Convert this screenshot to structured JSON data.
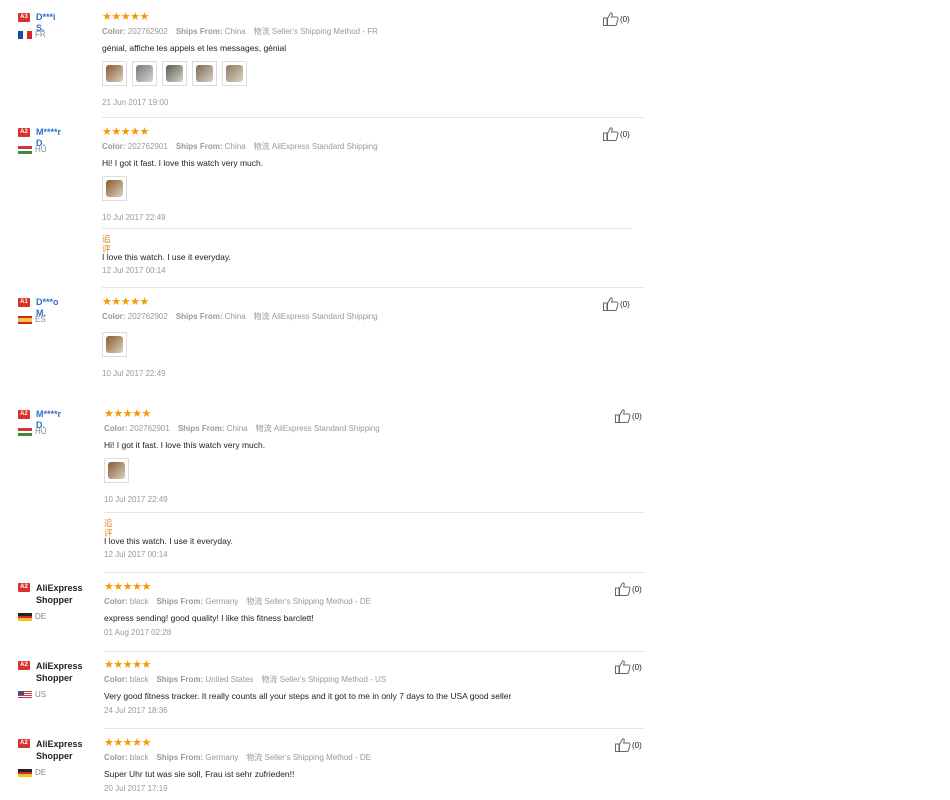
{
  "helpful_count": "(0)",
  "labels": {
    "color": "Color:",
    "ships_from": "Ships From:",
    "logistics": "物流",
    "additional": "追评"
  },
  "reviews": [
    {
      "level": "A3",
      "name": "D***i S.",
      "country": "FR",
      "color": "202762902",
      "ships_from": "China",
      "method": "Seller's Shipping Method - FR",
      "text": "génial, affiche les appels et les messages, génial",
      "photos": 5,
      "date": "21 Jun 2017 19:00"
    },
    {
      "level": "A2",
      "name": "M****r D.",
      "country": "HU",
      "color": "202762901",
      "ships_from": "China",
      "method": "AliExpress Standard Shipping",
      "text": "Hi! I got it fast. I love this watch very much.",
      "photos": 1,
      "date": "10 Jul 2017 22:49",
      "followup_text": "I love this watch. I use it everyday.",
      "followup_date": "12 Jul 2017 00:14"
    },
    {
      "level": "A1",
      "name": "D***o M.",
      "country": "ES",
      "color": "202762902",
      "ships_from": "China",
      "method": "AliExpress Standard Shipping",
      "photos": 1,
      "date": "10 Jul 2017 22:49"
    },
    {
      "level": "A2",
      "name": "M****r D.",
      "country": "HU",
      "color": "202762901",
      "ships_from": "China",
      "method": "AliExpress Standard Shipping",
      "text": "Hi! I got it fast. I love this watch very much.",
      "photos": 1,
      "date": "10 Jul 2017 22:49",
      "followup_text": "I love this watch. I use it everyday.",
      "followup_date": "12 Jul 2017 00:14"
    },
    {
      "level": "A2",
      "name": "AliExpress Shopper",
      "country": "DE",
      "color": "black",
      "ships_from": "Germany",
      "method": "Seller's Shipping Method - DE",
      "text": "express sending! good quality! I like this fitness barclett!",
      "date": "01 Aug 2017 02:28"
    },
    {
      "level": "A2",
      "name": "AliExpress Shopper",
      "country": "US",
      "color": "black",
      "ships_from": "United States",
      "method": "Seller's Shipping Method - US",
      "text": "Very good fitness tracker. It really counts all your steps and it got to me in only 7 days to the USA good seller",
      "date": "24 Jul 2017 18:36"
    },
    {
      "level": "A2",
      "name": "AliExpress Shopper",
      "country": "DE",
      "color": "black",
      "ships_from": "Germany",
      "method": "Seller's Shipping Method - DE",
      "text": "Super Uhr tut was sie soll, Frau ist sehr zufrieden!!",
      "date": "20 Jul 2017 17:19"
    }
  ]
}
